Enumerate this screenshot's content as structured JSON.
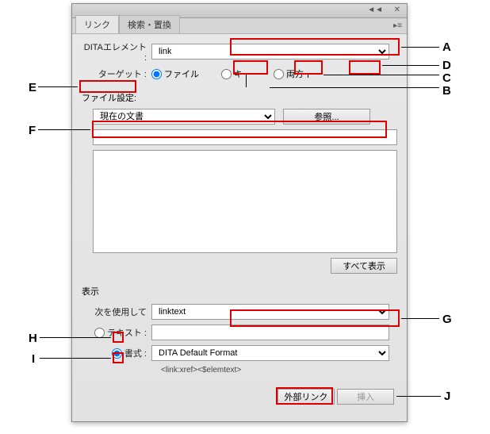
{
  "tabs": {
    "link": "リンク",
    "search": "検索・置換"
  },
  "ditaElement": {
    "label": "DITAエレメント :",
    "value": "link"
  },
  "target": {
    "label": "ターゲット :",
    "file": "ファイル",
    "key": "キー",
    "both": "両方"
  },
  "fileSettings": {
    "header": "ファイル設定:",
    "scope": "現在の文書",
    "browse": "参照...",
    "path": "",
    "showAll": "すべて表示"
  },
  "display": {
    "header": "表示",
    "usingLabel": "次を使用して",
    "usingValue": "linktext",
    "textLabel": "テキスト :",
    "textValue": "",
    "formatLabel": "書式 :",
    "formatValue": "DITA Default Format",
    "formatNote": "<link:xref><$elemtext>"
  },
  "footer": {
    "external": "外部リンク",
    "insert": "挿入"
  },
  "callouts": {
    "A": "A",
    "B": "B",
    "C": "C",
    "D": "D",
    "E": "E",
    "F": "F",
    "G": "G",
    "H": "H",
    "I": "I",
    "J": "J"
  }
}
